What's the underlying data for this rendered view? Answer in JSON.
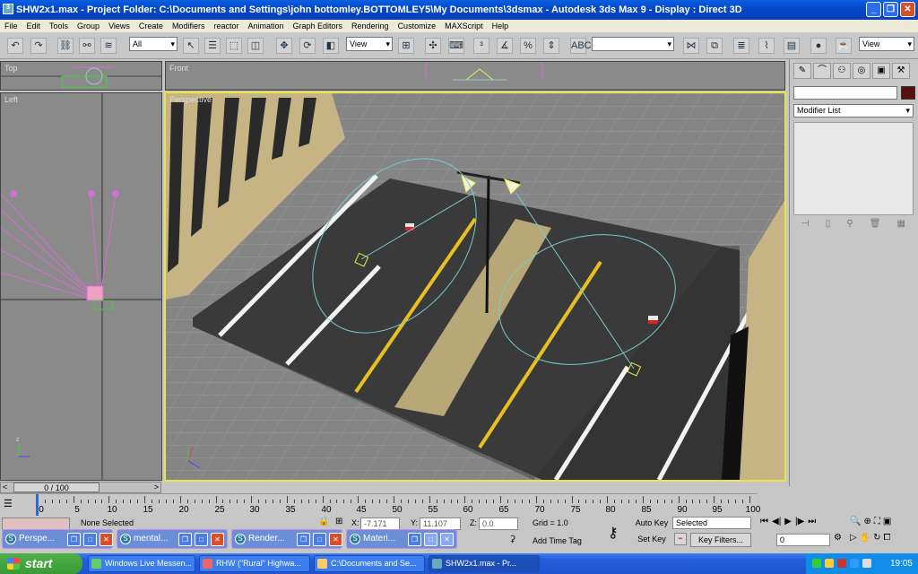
{
  "window": {
    "title": "SHW2x1.max    - Project Folder: C:\\Documents and Settings\\john bottomley.BOTTOMLEY5\\My Documents\\3dsmax    - Autodesk 3ds Max 9    - Display : Direct 3D"
  },
  "menu": [
    "File",
    "Edit",
    "Tools",
    "Group",
    "Views",
    "Create",
    "Modifiers",
    "reactor",
    "Animation",
    "Graph Editors",
    "Rendering",
    "Customize",
    "MAXScript",
    "Help"
  ],
  "toolbar": {
    "selection_filter": "All",
    "ref_coord": "View",
    "named_selection": "",
    "render_view": "View"
  },
  "viewports": {
    "top": "Top",
    "front": "Front",
    "left": "Left",
    "perspective": "Perspective"
  },
  "command_panel": {
    "modifier_list": "Modifier List",
    "object_color": "#5a0f0f"
  },
  "timeline": {
    "frame_display": "0 / 100",
    "ticks": [
      "0",
      "5",
      "10",
      "15",
      "20",
      "25",
      "30",
      "35",
      "40",
      "45",
      "50",
      "55",
      "60",
      "65",
      "70",
      "75",
      "80",
      "85",
      "90",
      "95",
      "100"
    ]
  },
  "status": {
    "selection": "None Selected",
    "x_label": "X:",
    "x_value": "-7.171",
    "y_label": "Y:",
    "y_value": "11.107",
    "z_label": "Z:",
    "z_value": "0.0",
    "grid": "Grid = 1.0",
    "add_time_tag": "Add Time Tag",
    "auto_key": "Auto Key",
    "auto_key_mode": "Selected",
    "set_key": "Set Key",
    "key_filters": "Key Filters...",
    "current_frame": "0"
  },
  "floating_windows": [
    {
      "label": "Perspe..."
    },
    {
      "label": "mental..."
    },
    {
      "label": "Render..."
    },
    {
      "label": "Materi..."
    }
  ],
  "taskbar": {
    "start": "start",
    "tasks": [
      {
        "label": "Windows Live Messen..."
      },
      {
        "label": "RHW (\"Rural\" Highwa..."
      },
      {
        "label": "C:\\Documents and Se..."
      },
      {
        "label": "SHW2x1.max    - Pr..."
      }
    ],
    "clock": "19:05"
  }
}
